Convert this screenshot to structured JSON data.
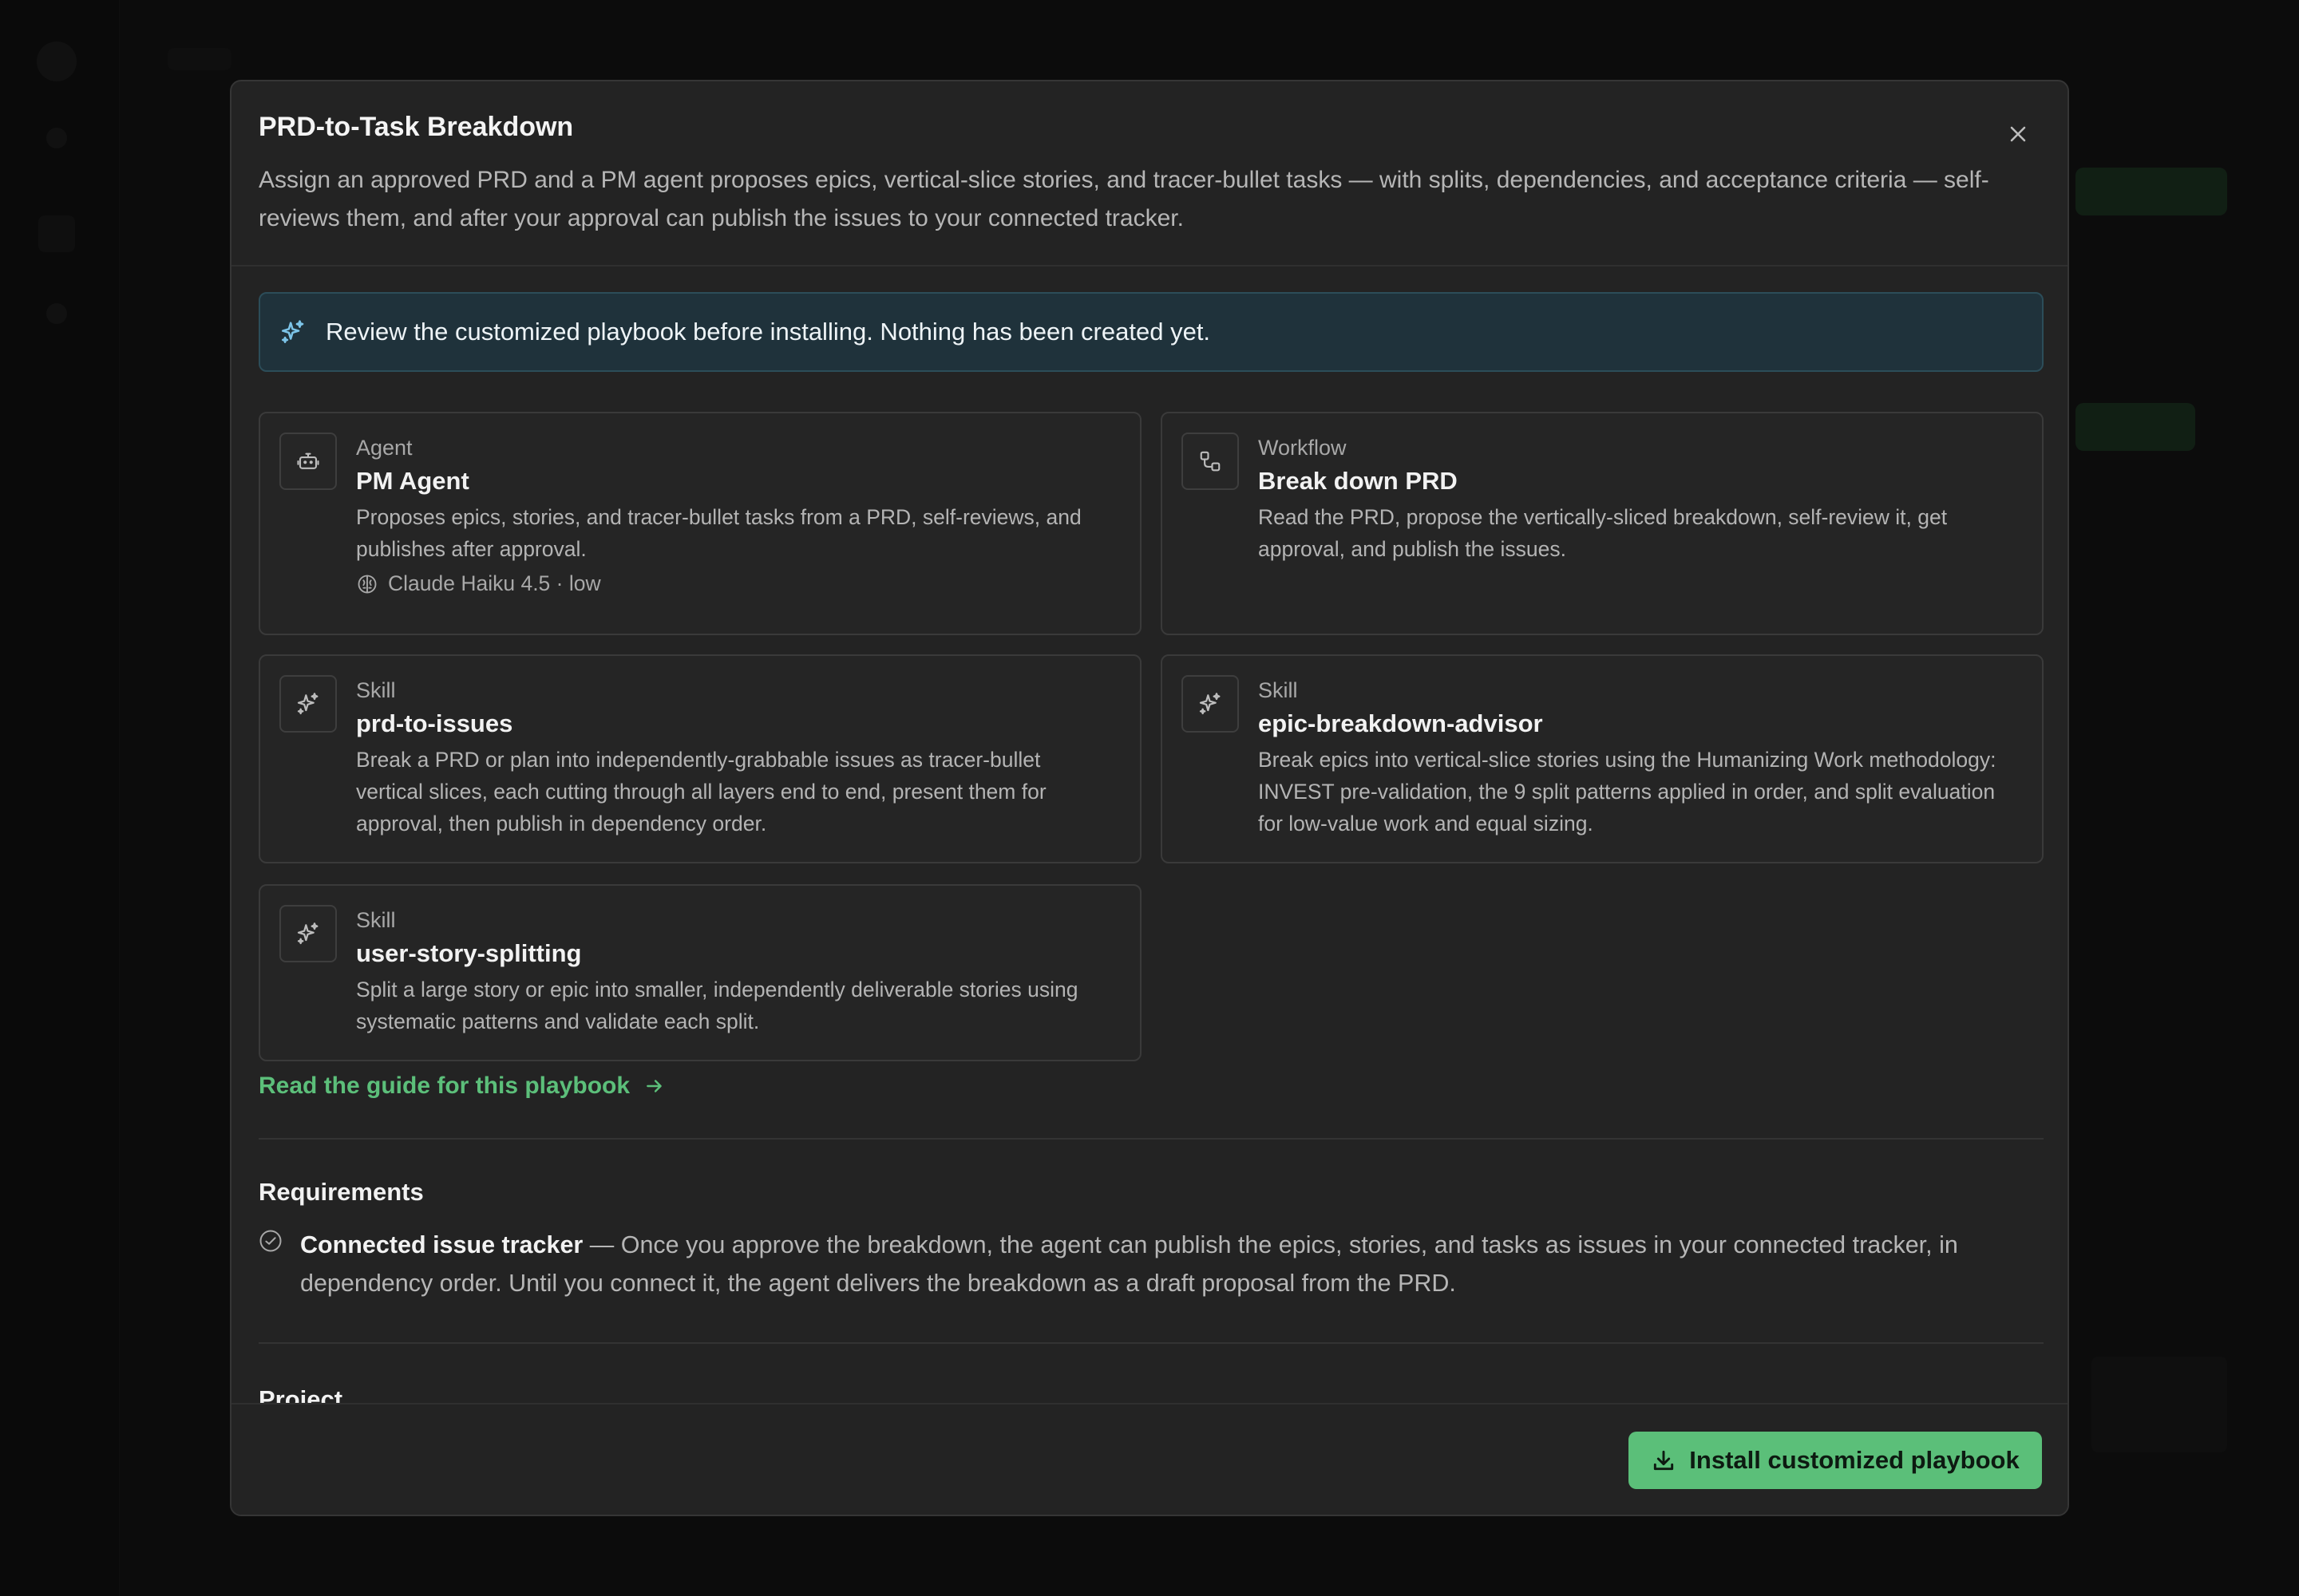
{
  "modal": {
    "title": "PRD-to-Task Breakdown",
    "description": "Assign an approved PRD and a PM agent proposes epics, vertical-slice stories, and tracer-bullet tasks — with splits, dependencies, and acceptance criteria — self-reviews them, and after your approval can publish the issues to your connected tracker.",
    "close_icon": "close-icon"
  },
  "banner": {
    "icon": "sparkles-icon",
    "text": "Review the customized playbook before installing. Nothing has been created yet.",
    "bg_color": "#1f323b",
    "icon_color": "#7cc4e8"
  },
  "cards": [
    {
      "kind": "Agent",
      "icon": "robot-icon",
      "title": "PM Agent",
      "description": "Proposes epics, stories, and tracer-bullet tasks from a PRD, self-reviews, and publishes after approval.",
      "meta": "Claude Haiku 4.5 · low",
      "meta_icon": "brain-icon"
    },
    {
      "kind": "Workflow",
      "icon": "workflow-icon",
      "title": "Break down PRD",
      "description": "Read the PRD, propose the vertically-sliced breakdown, self-review it, get approval, and publish the issues."
    },
    {
      "kind": "Skill",
      "icon": "sparkles-icon",
      "title": "prd-to-issues",
      "description": "Break a PRD or plan into independently-grabbable issues as tracer-bullet vertical slices, each cutting through all layers end to end, present them for approval, then publish in dependency order."
    },
    {
      "kind": "Skill",
      "icon": "sparkles-icon",
      "title": "epic-breakdown-advisor",
      "description": "Break epics into vertical-slice stories using the Humanizing Work methodology: INVEST pre-validation, the 9 split patterns applied in order, and split evaluation for low-value work and equal sizing."
    },
    {
      "kind": "Skill",
      "icon": "sparkles-icon",
      "title": "user-story-splitting",
      "description": "Split a large story or epic into smaller, independently deliverable stories using systematic patterns and validate each split."
    }
  ],
  "guide_link": {
    "label": "Read the guide for this playbook",
    "icon": "arrow-right-icon",
    "color": "#5cbf7a"
  },
  "requirements": {
    "title": "Requirements",
    "items": [
      {
        "icon": "check-circle-icon",
        "name": "Connected issue tracker",
        "text": " — Once you approve the breakdown, the agent can publish the epics, stories, and tasks as issues in your connected tracker, in dependency order. Until you connect it, the agent delivers the breakdown as a draft proposal from the PRD."
      }
    ],
    "next_section_peek": "Project"
  },
  "footer": {
    "install_label": "Install customized playbook",
    "install_icon": "download-icon",
    "install_color": "#5bbf79"
  }
}
